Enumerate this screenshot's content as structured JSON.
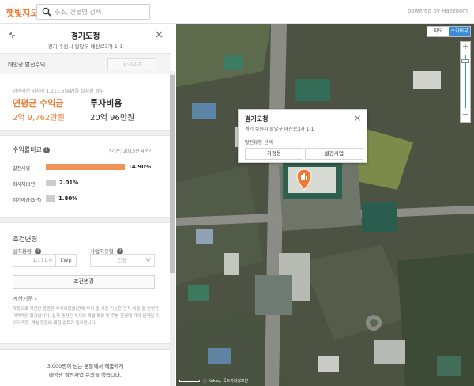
{
  "app": {
    "logo": "햇빛지도",
    "search_placeholder": "주소, 건물명 검색",
    "powered_by": "powered by Haezoom"
  },
  "panel": {
    "title": "경기도청",
    "address": "경기 수원시 팔달구 매산로3가 1-1",
    "type_label": "태양광 발전수익",
    "type_select": "1~12년",
    "summary_note": "검색하신 위치에 1,111.65kW를 설치할 경우",
    "avg_profit_label": "연평균 수익금",
    "avg_profit_value": "2억 9,762만원",
    "investment_label": "투자비용",
    "investment_value": "20억 96만원"
  },
  "comparison": {
    "title": "수익률비교",
    "info": "?",
    "basis": "*기준: 2015년 4분기",
    "bars": [
      {
        "label": "발전사업",
        "percent_text": "14.90%",
        "value": 14.9,
        "color": "#ee9457"
      },
      {
        "label": "회사채(3년)",
        "percent_text": "2.01%",
        "value": 2.01,
        "color": "#cccccc"
      },
      {
        "label": "정기예금(3년)",
        "percent_text": "1.80%",
        "value": 1.8,
        "color": "#cccccc"
      }
    ]
  },
  "conditions": {
    "title": "조건변경",
    "capacity_label": "설치용량",
    "capacity_value": "1,111.6",
    "capacity_unit": "kWp",
    "biz_label": "사업지유형",
    "biz_value": "건물",
    "apply_button": "조건변경",
    "calc_basis": "계산기준",
    "calc_text": "자동으로 계산된 용량은 부지이용률(전체 부지 중 사용 가능한 면적 비율)을 반영한 대략적인 결과입니다. 실제 용량은 부지의 개별 특성 및 주변 환경에 따라 달라질 수 있으므로, 개별 현장에 대한 검토가 필요합니다.",
    "cta_line1": "3,000명이 넘는 분들께서 해줌에게",
    "cta_line2": "태양광 발전사업 문의를 했습니다."
  },
  "map": {
    "type_map": "지도",
    "type_sky": "스카이뷰",
    "zoom_in": "+",
    "zoom_out": "−",
    "popup_title": "경기도청",
    "popup_address": "경기 수원시 팔달구 매산로3가 1-1",
    "popup_type_label": "발전유형 선택",
    "popup_btn_home": "가정용",
    "popup_btn_biz": "발전사업",
    "copyright": "ⓒ Kakao, 국토지리정보원"
  },
  "colors": {
    "accent": "#ee7a33",
    "skyview": "#3a8bd8"
  }
}
